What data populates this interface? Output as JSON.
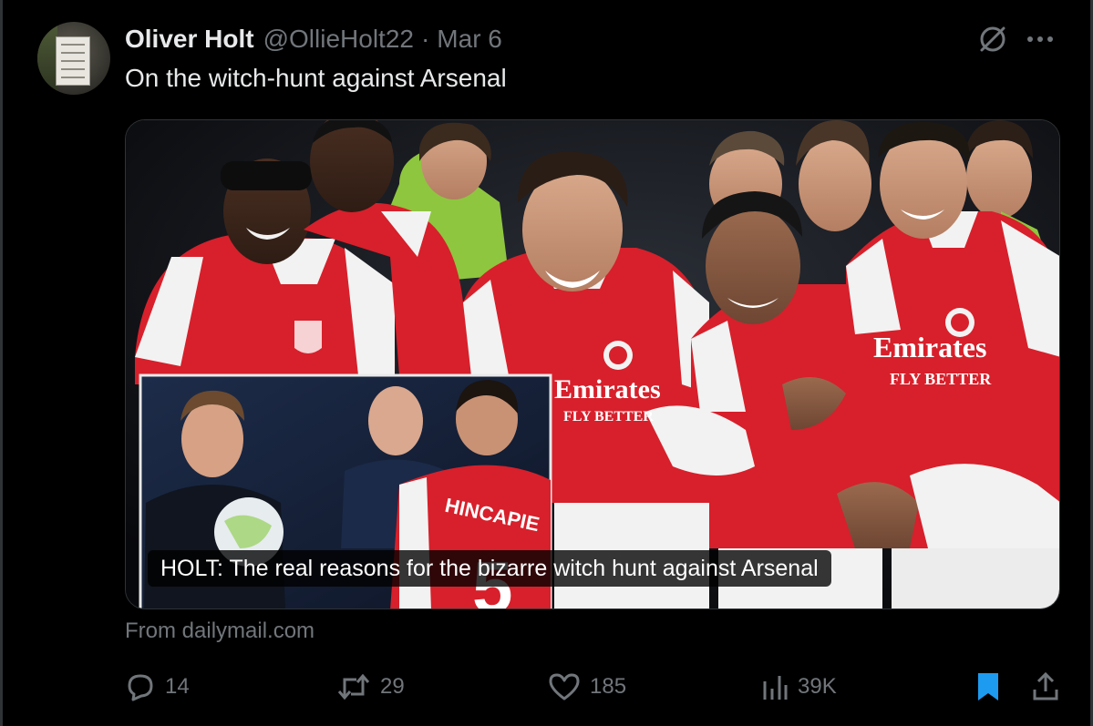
{
  "author": {
    "name": "Oliver Holt",
    "handle": "@OllieHolt22",
    "separator": "·",
    "date": "Mar 6"
  },
  "tweet": {
    "text": "On the witch-hunt against Arsenal"
  },
  "card": {
    "caption": "HOLT: The real reasons for the bizarre witch hunt against Arsenal",
    "source": "From dailymail.com",
    "shirt_sponsor": "Emirates",
    "shirt_tagline": "FLY BETTER",
    "inset_shirt_name": "HINCAPIE",
    "inset_shirt_number": "5",
    "team_colors": {
      "red": "#d7202b",
      "white": "#f2f2f2",
      "dark": "#0d1017"
    }
  },
  "actions": {
    "replies": "14",
    "reposts": "29",
    "likes": "185",
    "views": "39K"
  },
  "icons": {
    "grok": "grok-icon",
    "more": "more-icon",
    "reply": "reply-icon",
    "repost": "repost-icon",
    "like": "like-icon",
    "views": "views-icon",
    "bookmark": "bookmark-icon",
    "share": "share-icon"
  },
  "colors": {
    "background": "#000000",
    "text_primary": "#e7e9ea",
    "text_secondary": "#71767b",
    "accent": "#1d9bf0",
    "border": "#2f3336"
  }
}
